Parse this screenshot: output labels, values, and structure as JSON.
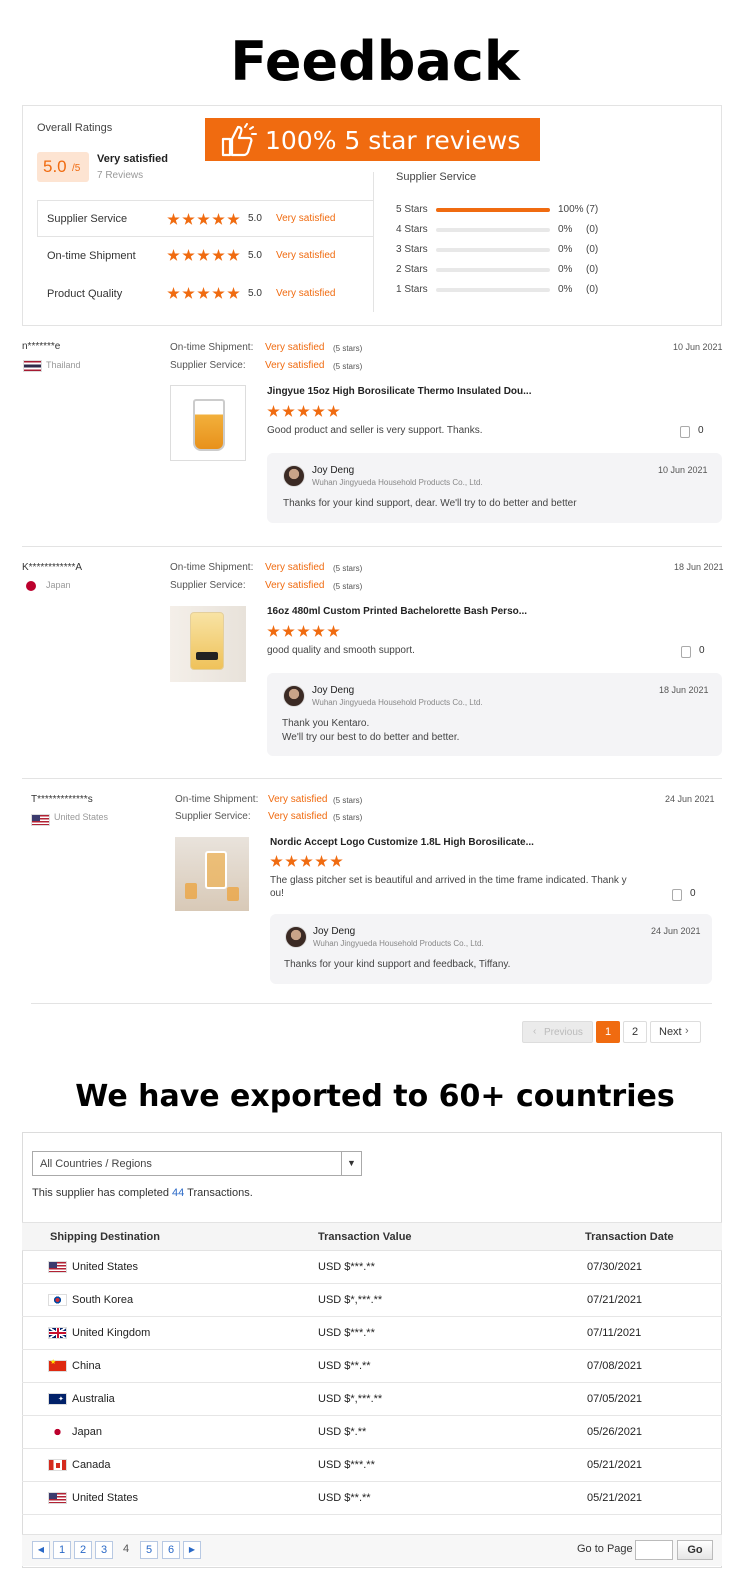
{
  "feedback_title": "Feedback",
  "ratings": {
    "overall_label": "Overall Ratings",
    "score": "5.0",
    "score_suffix": "/5",
    "summary": "Very satisfied",
    "review_count": "7 Reviews",
    "banner": "100% 5 star reviews",
    "categories": [
      {
        "label": "Supplier Service",
        "score": "5.0",
        "status": "Very satisfied"
      },
      {
        "label": "On-time Shipment",
        "score": "5.0",
        "status": "Very satisfied"
      },
      {
        "label": "Product Quality",
        "score": "5.0",
        "status": "Very satisfied"
      }
    ],
    "breakdown_title": "Supplier Service",
    "breakdown": [
      {
        "label": "5 Stars",
        "pct": "100%",
        "count": "(7)",
        "fraction": 1.0
      },
      {
        "label": "4 Stars",
        "pct": "0%",
        "count": "(0)",
        "fraction": 0
      },
      {
        "label": "3 Stars",
        "pct": "0%",
        "count": "(0)",
        "fraction": 0
      },
      {
        "label": "2 Stars",
        "pct": "0%",
        "count": "(0)",
        "fraction": 0
      },
      {
        "label": "1 Stars",
        "pct": "0%",
        "count": "(0)",
        "fraction": 0
      }
    ]
  },
  "reviews": [
    {
      "user": "n*******e",
      "country": "Thailand",
      "date": "10 Jun 2021",
      "shipment_label": "On-time Shipment:",
      "shipment_status": "Very satisfied",
      "shipment_stars": "(5 stars)",
      "service_label": "Supplier Service:",
      "service_status": "Very satisfied",
      "service_stars": "(5 stars)",
      "product": "Jingyue 15oz High Borosilicate Thermo Insulated Dou...",
      "comment": "Good product and seller is very support. Thanks.",
      "likes": "0",
      "reply_name": "Joy Deng",
      "reply_company": "Wuhan Jingyueda Household Products Co., Ltd.",
      "reply_date": "10 Jun 2021",
      "reply_text": "Thanks for your kind support, dear. We'll try to do better and better"
    },
    {
      "user": "K************A",
      "country": "Japan",
      "date": "18 Jun 2021",
      "shipment_label": "On-time Shipment:",
      "shipment_status": "Very satisfied",
      "shipment_stars": "(5 stars)",
      "service_label": "Supplier Service:",
      "service_status": "Very satisfied",
      "service_stars": "(5 stars)",
      "product": "16oz 480ml Custom Printed Bachelorette Bash Perso...",
      "comment": "good quality and smooth support.",
      "likes": "0",
      "reply_name": "Joy Deng",
      "reply_company": "Wuhan Jingyueda Household Products Co., Ltd.",
      "reply_date": "18 Jun 2021",
      "reply_text_1": "Thank you Kentaro.",
      "reply_text_2": "We'll try our best to do better and better."
    },
    {
      "user": "T*************s",
      "country": "United States",
      "date": "24 Jun 2021",
      "shipment_label": "On-time Shipment:",
      "shipment_status": "Very satisfied",
      "shipment_stars": "(5 stars)",
      "service_label": "Supplier Service:",
      "service_status": "Very satisfied",
      "service_stars": "(5 stars)",
      "product": "Nordic Accept Logo Customize 1.8L High Borosilicate...",
      "comment_1": "The glass pitcher set is beautiful and arrived in the time frame indicated. Thank y",
      "comment_2": "ou!",
      "likes": "0",
      "reply_name": "Joy Deng",
      "reply_company": "Wuhan Jingyueda Household Products Co., Ltd.",
      "reply_date": "24 Jun 2021",
      "reply_text": "Thanks for your kind support and feedback, Tiffany."
    }
  ],
  "review_pagination": {
    "previous": "Previous",
    "pages": [
      "1",
      "2"
    ],
    "next": "Next"
  },
  "export_title": "We have exported to 60+ countries",
  "transactions": {
    "filter_value": "All Countries / Regions",
    "summary_prefix": "This supplier has completed",
    "summary_count": "44",
    "summary_suffix": "Transactions.",
    "headers": [
      "Shipping Destination",
      "Transaction Value",
      "Transaction Date"
    ],
    "rows": [
      {
        "flag": "us",
        "country": "United States",
        "value": "USD $***.**",
        "date": "07/30/2021"
      },
      {
        "flag": "kr",
        "country": "South Korea",
        "value": "USD $*,***.**",
        "date": "07/21/2021"
      },
      {
        "flag": "gb",
        "country": "United Kingdom",
        "value": "USD $***.**",
        "date": "07/11/2021"
      },
      {
        "flag": "cn",
        "country": "China",
        "value": "USD $**.**",
        "date": "07/08/2021"
      },
      {
        "flag": "au",
        "country": "Australia",
        "value": "USD $*,***.**",
        "date": "07/05/2021"
      },
      {
        "flag": "jp",
        "country": "Japan",
        "value": "USD $*.**",
        "date": "05/26/2021"
      },
      {
        "flag": "ca",
        "country": "Canada",
        "value": "USD $***.**",
        "date": "05/21/2021"
      },
      {
        "flag": "us",
        "country": "United States",
        "value": "USD $**.**",
        "date": "05/21/2021"
      }
    ],
    "pages": [
      "1",
      "2",
      "3",
      "4",
      "5",
      "6"
    ],
    "current_page": "4",
    "goto_label": "Go to Page",
    "go_button": "Go"
  },
  "colors": {
    "accent": "#f06b10",
    "link": "#2a69c7"
  }
}
